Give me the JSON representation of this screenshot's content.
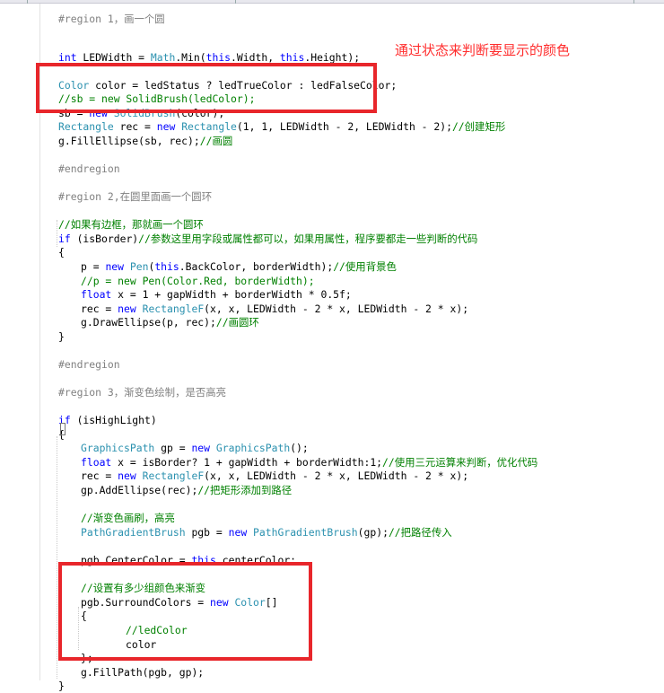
{
  "annotation": "通过状态来判断要显示的颜色",
  "code": {
    "lines": [
      {
        "t": 0,
        "i": 0,
        "tokens": [
          {
            "c": "rg",
            "v": "#region 1，画一个圆"
          }
        ]
      },
      {
        "t": 43,
        "i": 0,
        "tokens": [
          {
            "c": "kw",
            "v": "int"
          },
          {
            "c": "pl",
            "v": " LEDWidth = "
          },
          {
            "c": "ty",
            "v": "Math"
          },
          {
            "c": "pl",
            "v": ".Min("
          },
          {
            "c": "kw",
            "v": "this"
          },
          {
            "c": "pl",
            "v": ".Width, "
          },
          {
            "c": "kw",
            "v": "this"
          },
          {
            "c": "pl",
            "v": ".Height);"
          }
        ]
      },
      {
        "t": 74,
        "i": 0,
        "tokens": [
          {
            "c": "ty",
            "v": "Color"
          },
          {
            "c": "pl",
            "v": " color = ledStatus ? ledTrueColor : ledFalseColor;"
          }
        ]
      },
      {
        "t": 89,
        "i": 0,
        "tokens": [
          {
            "c": "cm",
            "v": "//sb = new SolidBrush(ledColor);"
          }
        ]
      },
      {
        "t": 105,
        "i": 0,
        "tokens": [
          {
            "c": "pl",
            "v": "sb = "
          },
          {
            "c": "kw",
            "v": "new"
          },
          {
            "c": "pl",
            "v": " "
          },
          {
            "c": "ty",
            "v": "SolidBrush"
          },
          {
            "c": "pl",
            "v": "(color);"
          }
        ]
      },
      {
        "t": 120,
        "i": 0,
        "tokens": [
          {
            "c": "ty",
            "v": "Rectangle"
          },
          {
            "c": "pl",
            "v": " rec = "
          },
          {
            "c": "kw",
            "v": "new"
          },
          {
            "c": "pl",
            "v": " "
          },
          {
            "c": "ty",
            "v": "Rectangle"
          },
          {
            "c": "pl",
            "v": "(1, 1, LEDWidth - 2, LEDWidth - 2);"
          },
          {
            "c": "cm",
            "v": "//创建矩形"
          }
        ]
      },
      {
        "t": 136,
        "i": 0,
        "tokens": [
          {
            "c": "pl",
            "v": "g.FillEllipse(sb, rec);"
          },
          {
            "c": "cm",
            "v": "//画圆"
          }
        ]
      },
      {
        "t": 167,
        "i": 0,
        "tokens": [
          {
            "c": "rg",
            "v": "#endregion"
          }
        ]
      },
      {
        "t": 198,
        "i": 0,
        "tokens": [
          {
            "c": "rg",
            "v": "#region 2,在圆里面画一个圆环"
          }
        ]
      },
      {
        "t": 229,
        "i": 0,
        "tokens": [
          {
            "c": "cm",
            "v": "//如果有边框，那就画一个圆环"
          }
        ]
      },
      {
        "t": 245,
        "i": 0,
        "tokens": [
          {
            "c": "kw",
            "v": "if"
          },
          {
            "c": "pl",
            "v": " (isBorder)"
          },
          {
            "c": "cm",
            "v": "//参数这里用字段或属性都可以，如果用属性，程序要都走一些判断的代码"
          }
        ]
      },
      {
        "t": 260,
        "i": 0,
        "tokens": [
          {
            "c": "pl",
            "v": "{"
          }
        ]
      },
      {
        "t": 276,
        "i": 1,
        "tokens": [
          {
            "c": "pl",
            "v": "p = "
          },
          {
            "c": "kw",
            "v": "new"
          },
          {
            "c": "pl",
            "v": " "
          },
          {
            "c": "ty",
            "v": "Pen"
          },
          {
            "c": "pl",
            "v": "("
          },
          {
            "c": "kw",
            "v": "this"
          },
          {
            "c": "pl",
            "v": ".BackColor, borderWidth);"
          },
          {
            "c": "cm",
            "v": "//使用背景色"
          }
        ]
      },
      {
        "t": 292,
        "i": 1,
        "tokens": [
          {
            "c": "cm",
            "v": "//p = new Pen(Color.Red, borderWidth);"
          }
        ]
      },
      {
        "t": 307,
        "i": 1,
        "tokens": [
          {
            "c": "kw",
            "v": "float"
          },
          {
            "c": "pl",
            "v": " x = 1 + gapWidth + borderWidth * 0.5f;"
          }
        ]
      },
      {
        "t": 323,
        "i": 1,
        "tokens": [
          {
            "c": "pl",
            "v": "rec = "
          },
          {
            "c": "kw",
            "v": "new"
          },
          {
            "c": "pl",
            "v": " "
          },
          {
            "c": "ty",
            "v": "RectangleF"
          },
          {
            "c": "pl",
            "v": "(x, x, LEDWidth - 2 * x, LEDWidth - 2 * x);"
          }
        ]
      },
      {
        "t": 338,
        "i": 1,
        "tokens": [
          {
            "c": "pl",
            "v": "g.DrawEllipse(p, rec);"
          },
          {
            "c": "cm",
            "v": "//画圆环"
          }
        ]
      },
      {
        "t": 354,
        "i": 0,
        "tokens": [
          {
            "c": "pl",
            "v": "}"
          }
        ]
      },
      {
        "t": 385,
        "i": 0,
        "tokens": [
          {
            "c": "rg",
            "v": "#endregion"
          }
        ]
      },
      {
        "t": 416,
        "i": 0,
        "tokens": [
          {
            "c": "rg",
            "v": "#region 3，渐变色绘制，是否高亮"
          }
        ]
      },
      {
        "t": 447,
        "i": 0,
        "tokens": [
          {
            "c": "kw",
            "v": "if"
          },
          {
            "c": "pl",
            "v": " (isHighLight)"
          }
        ]
      },
      {
        "t": 463,
        "i": 0,
        "tokens": [
          {
            "c": "pl",
            "v": "{"
          }
        ]
      },
      {
        "t": 478,
        "i": 1,
        "tokens": [
          {
            "c": "ty",
            "v": "GraphicsPath"
          },
          {
            "c": "pl",
            "v": " gp = "
          },
          {
            "c": "kw",
            "v": "new"
          },
          {
            "c": "pl",
            "v": " "
          },
          {
            "c": "ty",
            "v": "GraphicsPath"
          },
          {
            "c": "pl",
            "v": "();"
          }
        ]
      },
      {
        "t": 494,
        "i": 1,
        "tokens": [
          {
            "c": "kw",
            "v": "float"
          },
          {
            "c": "pl",
            "v": " x = isBorder? 1 + gapWidth + borderWidth:1;"
          },
          {
            "c": "cm",
            "v": "//使用三元运算来判断，优化代码"
          }
        ]
      },
      {
        "t": 509,
        "i": 1,
        "tokens": [
          {
            "c": "pl",
            "v": "rec = "
          },
          {
            "c": "kw",
            "v": "new"
          },
          {
            "c": "pl",
            "v": " "
          },
          {
            "c": "ty",
            "v": "RectangleF"
          },
          {
            "c": "pl",
            "v": "(x, x, LEDWidth - 2 * x, LEDWidth - 2 * x);"
          }
        ]
      },
      {
        "t": 525,
        "i": 1,
        "tokens": [
          {
            "c": "pl",
            "v": "gp.AddEllipse(rec);"
          },
          {
            "c": "cm",
            "v": "//把矩形添加到路径"
          }
        ]
      },
      {
        "t": 556,
        "i": 1,
        "tokens": [
          {
            "c": "cm",
            "v": "//渐变色画刷，高亮"
          }
        ]
      },
      {
        "t": 572,
        "i": 1,
        "tokens": [
          {
            "c": "ty",
            "v": "PathGradientBrush"
          },
          {
            "c": "pl",
            "v": " pgb = "
          },
          {
            "c": "kw",
            "v": "new"
          },
          {
            "c": "pl",
            "v": " "
          },
          {
            "c": "ty",
            "v": "PathGradientBrush"
          },
          {
            "c": "pl",
            "v": "(gp);"
          },
          {
            "c": "cm",
            "v": "//把路径传入"
          }
        ]
      },
      {
        "t": 603,
        "i": 1,
        "tokens": [
          {
            "c": "pl",
            "v": "pgb.CenterColor = "
          },
          {
            "c": "kw",
            "v": "this"
          },
          {
            "c": "pl",
            "v": ".centerColor;"
          }
        ]
      },
      {
        "t": 634,
        "i": 1,
        "tokens": [
          {
            "c": "cm",
            "v": "//设置有多少组颜色来渐变"
          }
        ]
      },
      {
        "t": 650,
        "i": 1,
        "tokens": [
          {
            "c": "pl",
            "v": "pgb.SurroundColors = "
          },
          {
            "c": "kw",
            "v": "new"
          },
          {
            "c": "pl",
            "v": " "
          },
          {
            "c": "ty",
            "v": "Color"
          },
          {
            "c": "pl",
            "v": "[]"
          }
        ]
      },
      {
        "t": 665,
        "i": 1,
        "tokens": [
          {
            "c": "pl",
            "v": "{"
          }
        ]
      },
      {
        "t": 681,
        "i": 3,
        "tokens": [
          {
            "c": "cm",
            "v": "//ledColor"
          }
        ]
      },
      {
        "t": 697,
        "i": 3,
        "tokens": [
          {
            "c": "pl",
            "v": "color"
          }
        ]
      },
      {
        "t": 712,
        "i": 1,
        "tokens": [
          {
            "c": "pl",
            "v": "};"
          }
        ]
      },
      {
        "t": 728,
        "i": 1,
        "tokens": [
          {
            "c": "pl",
            "v": "g.FillPath(pgb, gp);"
          }
        ]
      },
      {
        "t": 743,
        "i": 0,
        "tokens": [
          {
            "c": "pl",
            "v": "}"
          }
        ]
      }
    ]
  }
}
